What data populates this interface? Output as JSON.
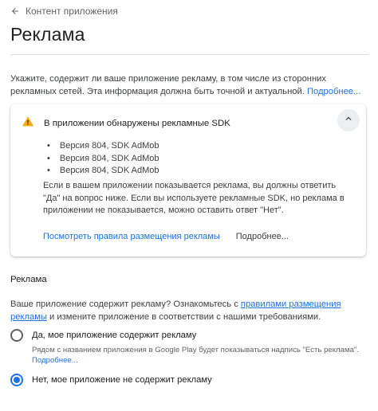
{
  "header": {
    "back_label": "Контент приложения",
    "title": "Реклама"
  },
  "intro": {
    "text": "Укажите, содержит ли ваше приложение рекламу, в том числе из сторонних рекламных сетей. Эта информация должна быть точной и актуальной.",
    "more_link": "Подробнее..."
  },
  "alert": {
    "title": "В приложении обнаружены рекламные SDK",
    "sdks": [
      "Версия 804, SDK AdMob",
      "Версия 804, SDK AdMob",
      "Версия 804, SDK AdMob"
    ],
    "body": "Если в вашем приложении показывается реклама, вы должны ответить \"Да\" на вопрос ниже. Если вы используете рекламные SDK, но реклама в приложении не показывается, можно оставить ответ \"Нет\".",
    "policy_link": "Посмотреть правила размещения рекламы",
    "more_link": "Подробнее...",
    "warning_color": "#f9ab00"
  },
  "ads_section": {
    "label": "Реклама",
    "question_part1": "Ваше приложение содержит рекламу? Ознакомьтесь с ",
    "question_link": "правилами размещения рекламы",
    "question_part2": " и измените приложение в соответствии с нашими требованиями.",
    "options": [
      {
        "label": "Да, мое приложение содержит рекламу",
        "description": "Рядом с названием приложения в Google Play будет показываться надпись \"Есть реклама\".",
        "description_link": "Подробнее...",
        "checked": false
      },
      {
        "label": "Нет, мое приложение не содержит рекламу",
        "checked": true
      }
    ]
  },
  "colors": {
    "accent": "#1a73e8",
    "text": "#202124",
    "muted": "#5f6368"
  }
}
